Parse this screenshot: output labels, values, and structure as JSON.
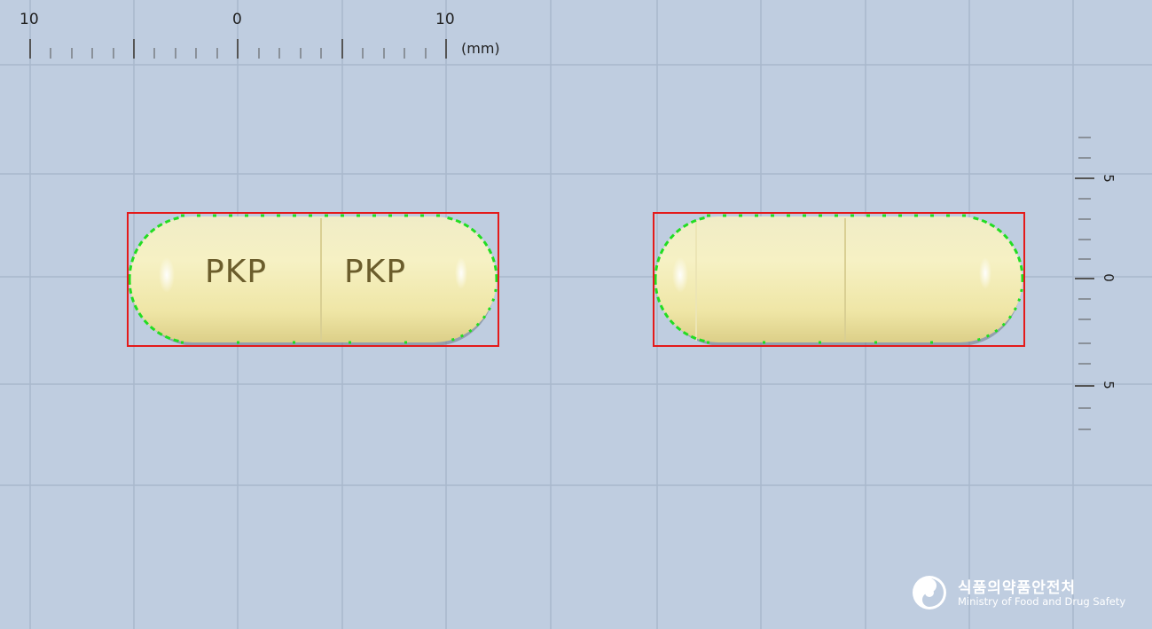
{
  "ruler": {
    "top_labels": [
      "10",
      "0",
      "10"
    ],
    "unit": "(mm)",
    "side_labels": [
      "5",
      "0",
      "5"
    ]
  },
  "pill_front": {
    "imprint_left": "PKP",
    "imprint_right": "PKP"
  },
  "logo": {
    "icon": "mfds-emblem-icon",
    "korean_name": "식품의약품안전처",
    "english_name": "Ministry of Food and Drug Safety"
  },
  "colors": {
    "background": "#bfcde0",
    "capsule": "#f3eebb",
    "bounding_box": "#e41a1a",
    "contour": "#22dd22"
  }
}
